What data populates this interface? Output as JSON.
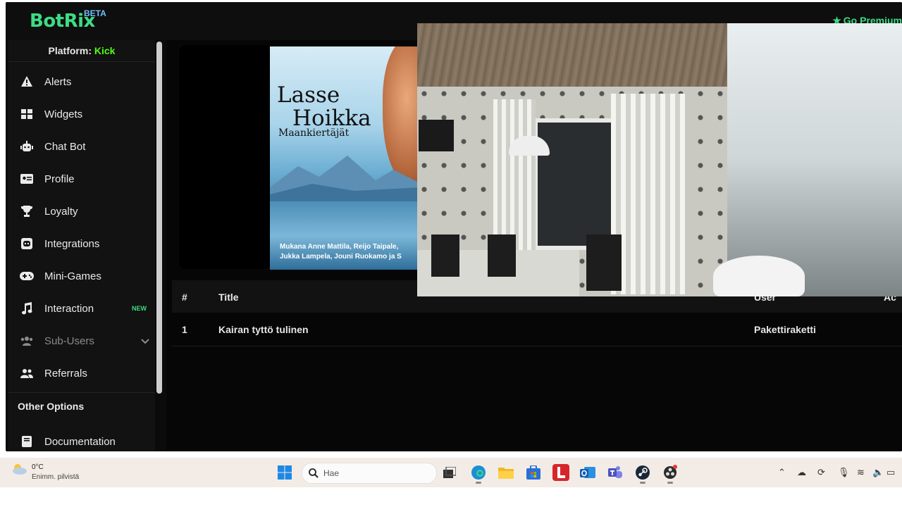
{
  "app": {
    "logo": "BotRix",
    "beta_badge": "BETA",
    "premium_label": "Go Premium",
    "platform_label": "Platform:",
    "platform_value": "Kick",
    "colors": {
      "accent": "#3ddc84",
      "kick": "#53fc18",
      "beta": "#6ec1ff"
    }
  },
  "sidebar": {
    "items": [
      {
        "label": "Alerts",
        "icon": "warning-icon"
      },
      {
        "label": "Widgets",
        "icon": "grid-icon"
      },
      {
        "label": "Chat Bot",
        "icon": "robot-icon"
      },
      {
        "label": "Profile",
        "icon": "id-card-icon"
      },
      {
        "label": "Loyalty",
        "icon": "trophy-icon"
      },
      {
        "label": "Integrations",
        "icon": "discord-icon"
      },
      {
        "label": "Mini-Games",
        "icon": "gamepad-icon"
      },
      {
        "label": "Interaction",
        "icon": "music-icon",
        "badge": "NEW"
      },
      {
        "label": "Sub-Users",
        "icon": "users-icon"
      },
      {
        "label": "Referrals",
        "icon": "user-group-icon"
      }
    ],
    "section_title": "Other Options",
    "doc_item": {
      "label": "Documentation",
      "icon": "book-icon"
    }
  },
  "player": {
    "album_title_1": "Lasse",
    "album_title_2": "Hoikka",
    "album_subtitle": "Maankiertäjät",
    "album_credits_1": "Mukana Anne Mattila, Reijo Taipale,",
    "album_credits_2": "Jukka Lampela, Jouni Ruokamo ja S"
  },
  "table": {
    "headers": [
      "#",
      "Title",
      "User",
      "Ac"
    ],
    "rows": [
      {
        "num": "1",
        "title": "Kairan tyttö tulinen",
        "user": "Pakettiraketti"
      }
    ]
  },
  "taskbar": {
    "temperature": "0°C",
    "weather_desc": "Enimm. pilvistä",
    "search_placeholder": "Hae"
  }
}
